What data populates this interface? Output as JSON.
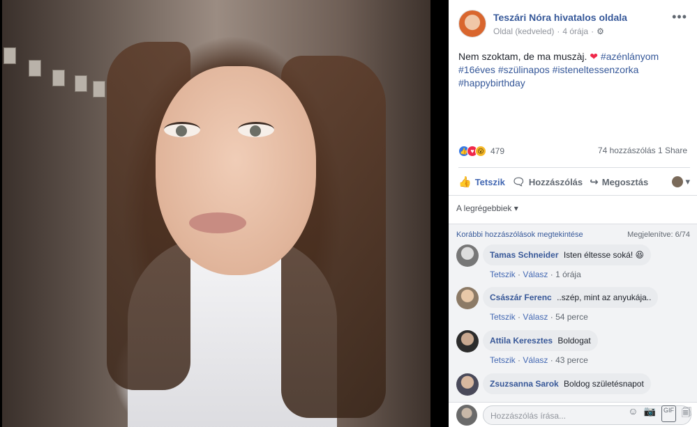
{
  "page": {
    "name": "Teszári Nóra hivatalos oldala",
    "meta_type": "Oldal (kedveled)",
    "meta_time": "4 órája"
  },
  "post": {
    "text_main": "Nem szoktam, de ma muszàj.",
    "heart": "❤",
    "tag1": "#azénlányom",
    "tag2": "#16éves",
    "tag3": "#szülinapos",
    "tag4": "#isteneltessenzorka",
    "tag5": "#happybirthday"
  },
  "stats": {
    "reaction_count": "479",
    "comments": "74 hozzászólás",
    "shares": "1 Share"
  },
  "actions": {
    "like": "Tetszik",
    "comment": "Hozzászólás",
    "share": "Megosztás"
  },
  "sort": {
    "label": "A legrégebbiek"
  },
  "comments_header": {
    "previous": "Korábbi hozzászólások megtekintése",
    "shown": "Megjelenítve: 6/74"
  },
  "comments": [
    {
      "author": "Tamas Schneider",
      "text": "Isten éltesse soká! 😆",
      "like": "Tetszik",
      "reply": "Válasz",
      "time": "1 órája"
    },
    {
      "author": "Császár Ferenc",
      "text": "..szép, mint az anyukája..",
      "like": "Tetszik",
      "reply": "Válasz",
      "time": "54 perce"
    },
    {
      "author": "Attila Keresztes",
      "text": "Boldogat",
      "like": "Tetszik",
      "reply": "Válasz",
      "time": "43 perce"
    },
    {
      "author": "Zsuzsanna Sarok",
      "text": "Boldog születésnapot",
      "like": "",
      "reply": "",
      "time": ""
    }
  ],
  "composer": {
    "placeholder": "Hozzászólás írása..."
  },
  "colors": {
    "link": "#365899",
    "action_active": "#4267b2",
    "background_comments": "#f2f3f5"
  }
}
